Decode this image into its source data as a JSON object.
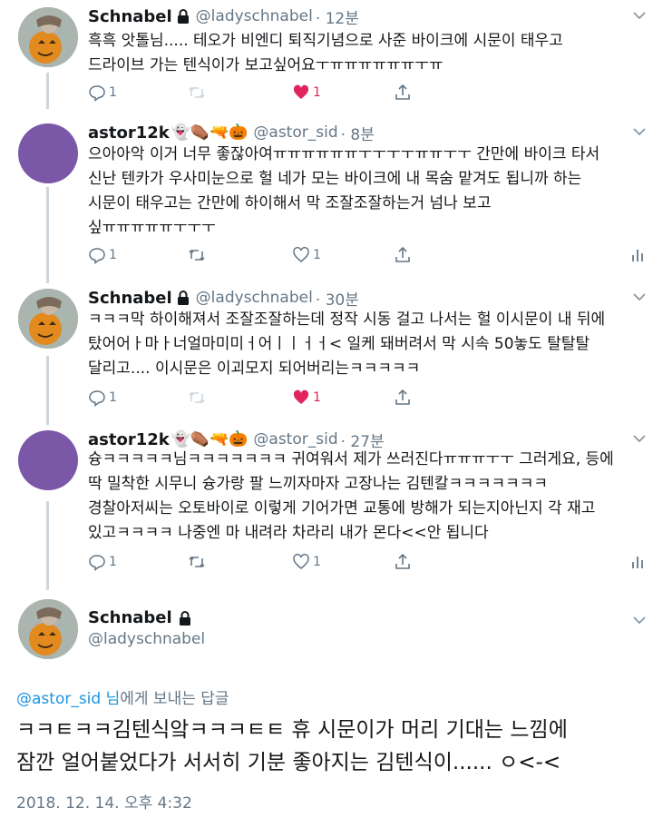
{
  "tweets": [
    {
      "name": "Schnabel",
      "handle": "@ladyschnabel",
      "time": "· 12분",
      "text": "흑흑 앗톨님..... 테오가 비엔디 퇴직기념으로 사준 바이크에 시문이 태우고\n드라이브 가는 텐식이가 보고싶어요ㅜㅠㅠㅠㅠㅠㅠㅜㅠ",
      "replies": "1",
      "retweets": "",
      "likes": "1",
      "liked": true
    },
    {
      "name": "astor12k",
      "emojis": "👻⚰️🔫🎃",
      "handle": "@astor_sid",
      "time": "· 8분",
      "text": "으아아악 이거 너무 좋잖아여ㅠㅠㅠㅠㅠㅠㅜㅜㅜㅜㅠㅠㅜㅜ 간만에 바이크 타서\n신난 텐카가 우사미눈으로 헐 네가 모는 바이크에 내 목숨 맡겨도 됩니까 하는\n시문이 태우고는 간만에 하이해서 막 조잘조잘하는거 넘나 보고\n싶ㅠㅠㅠㅠㅠㅜㅜㅜ",
      "replies": "1",
      "retweets": "",
      "likes": "1",
      "liked": false
    },
    {
      "name": "Schnabel",
      "handle": "@ladyschnabel",
      "time": "· 30분",
      "text": "ㅋㅋㅋ막 하이해져서 조잘조잘하는데 정작 시동 걸고 나서는 헐 이시문이 내 뒤에\n탔어어ㅏ마ㅏ너얼마미미ㅓ어ㅣㅣㅓㅓ< 일케 돼버려서 막 시속 50놓도 탈탈탈\n달리고.... 이시문은 이괴모지 되어버리는ㅋㅋㅋㅋㅋ",
      "replies": "1",
      "retweets": "",
      "likes": "1",
      "liked": true
    },
    {
      "name": "astor12k",
      "emojis": "👻⚰️🔫🎃",
      "handle": "@astor_sid",
      "time": "· 27분",
      "text": "슝ㅋㅋㅋㅋㅋ님ㅋㅋㅋㅋㅋㅋㅋ 귀여워서 제가 쓰러진다ㅠㅠㅠㅜㅜ 그러게요, 등에\n딱 밀착한 시무니 슝가랑 팔 느끼자마자 고장나는 김텐칼ㅋㅋㅋㅋㅋㅋㅋ\n경찰아저씨는 오토바이로 이렇게 기어가면 교통에 방해가 되는지아닌지 각 재고\n있고ㅋㅋㅋㅋ 나중엔 마 내려라 차라리 내가 몬다<<안 됩니다",
      "replies": "1",
      "retweets": "",
      "likes": "1",
      "liked": false
    }
  ],
  "main": {
    "name": "Schnabel",
    "handle": "@ladyschnabel",
    "reply_to_link": "@astor_sid 님",
    "reply_to_rest": "에게 보내는 답글",
    "text": "ㅋㅋㅌㅋㅋ김텐식앜ㅋㅋㅋㅌㅌ 휴 시문이가 머리 기대는 느낌에\n잠깐 얼어붙었다가 서서히 기분 좋아지는 김텐식이...... ㅇ<-<",
    "timestamp": "2018. 12. 14. 오후 4:32"
  },
  "colors": {
    "accent": "#1b95e0",
    "like": "#e0245e",
    "muted": "#657786",
    "thread_line": "#ccd6dd",
    "avatar_purple": "#7b57a8"
  },
  "icons": [
    "reply-icon",
    "retweet-icon",
    "like-icon",
    "share-icon",
    "analytics-icon",
    "lock-icon",
    "chevron-down-icon"
  ]
}
